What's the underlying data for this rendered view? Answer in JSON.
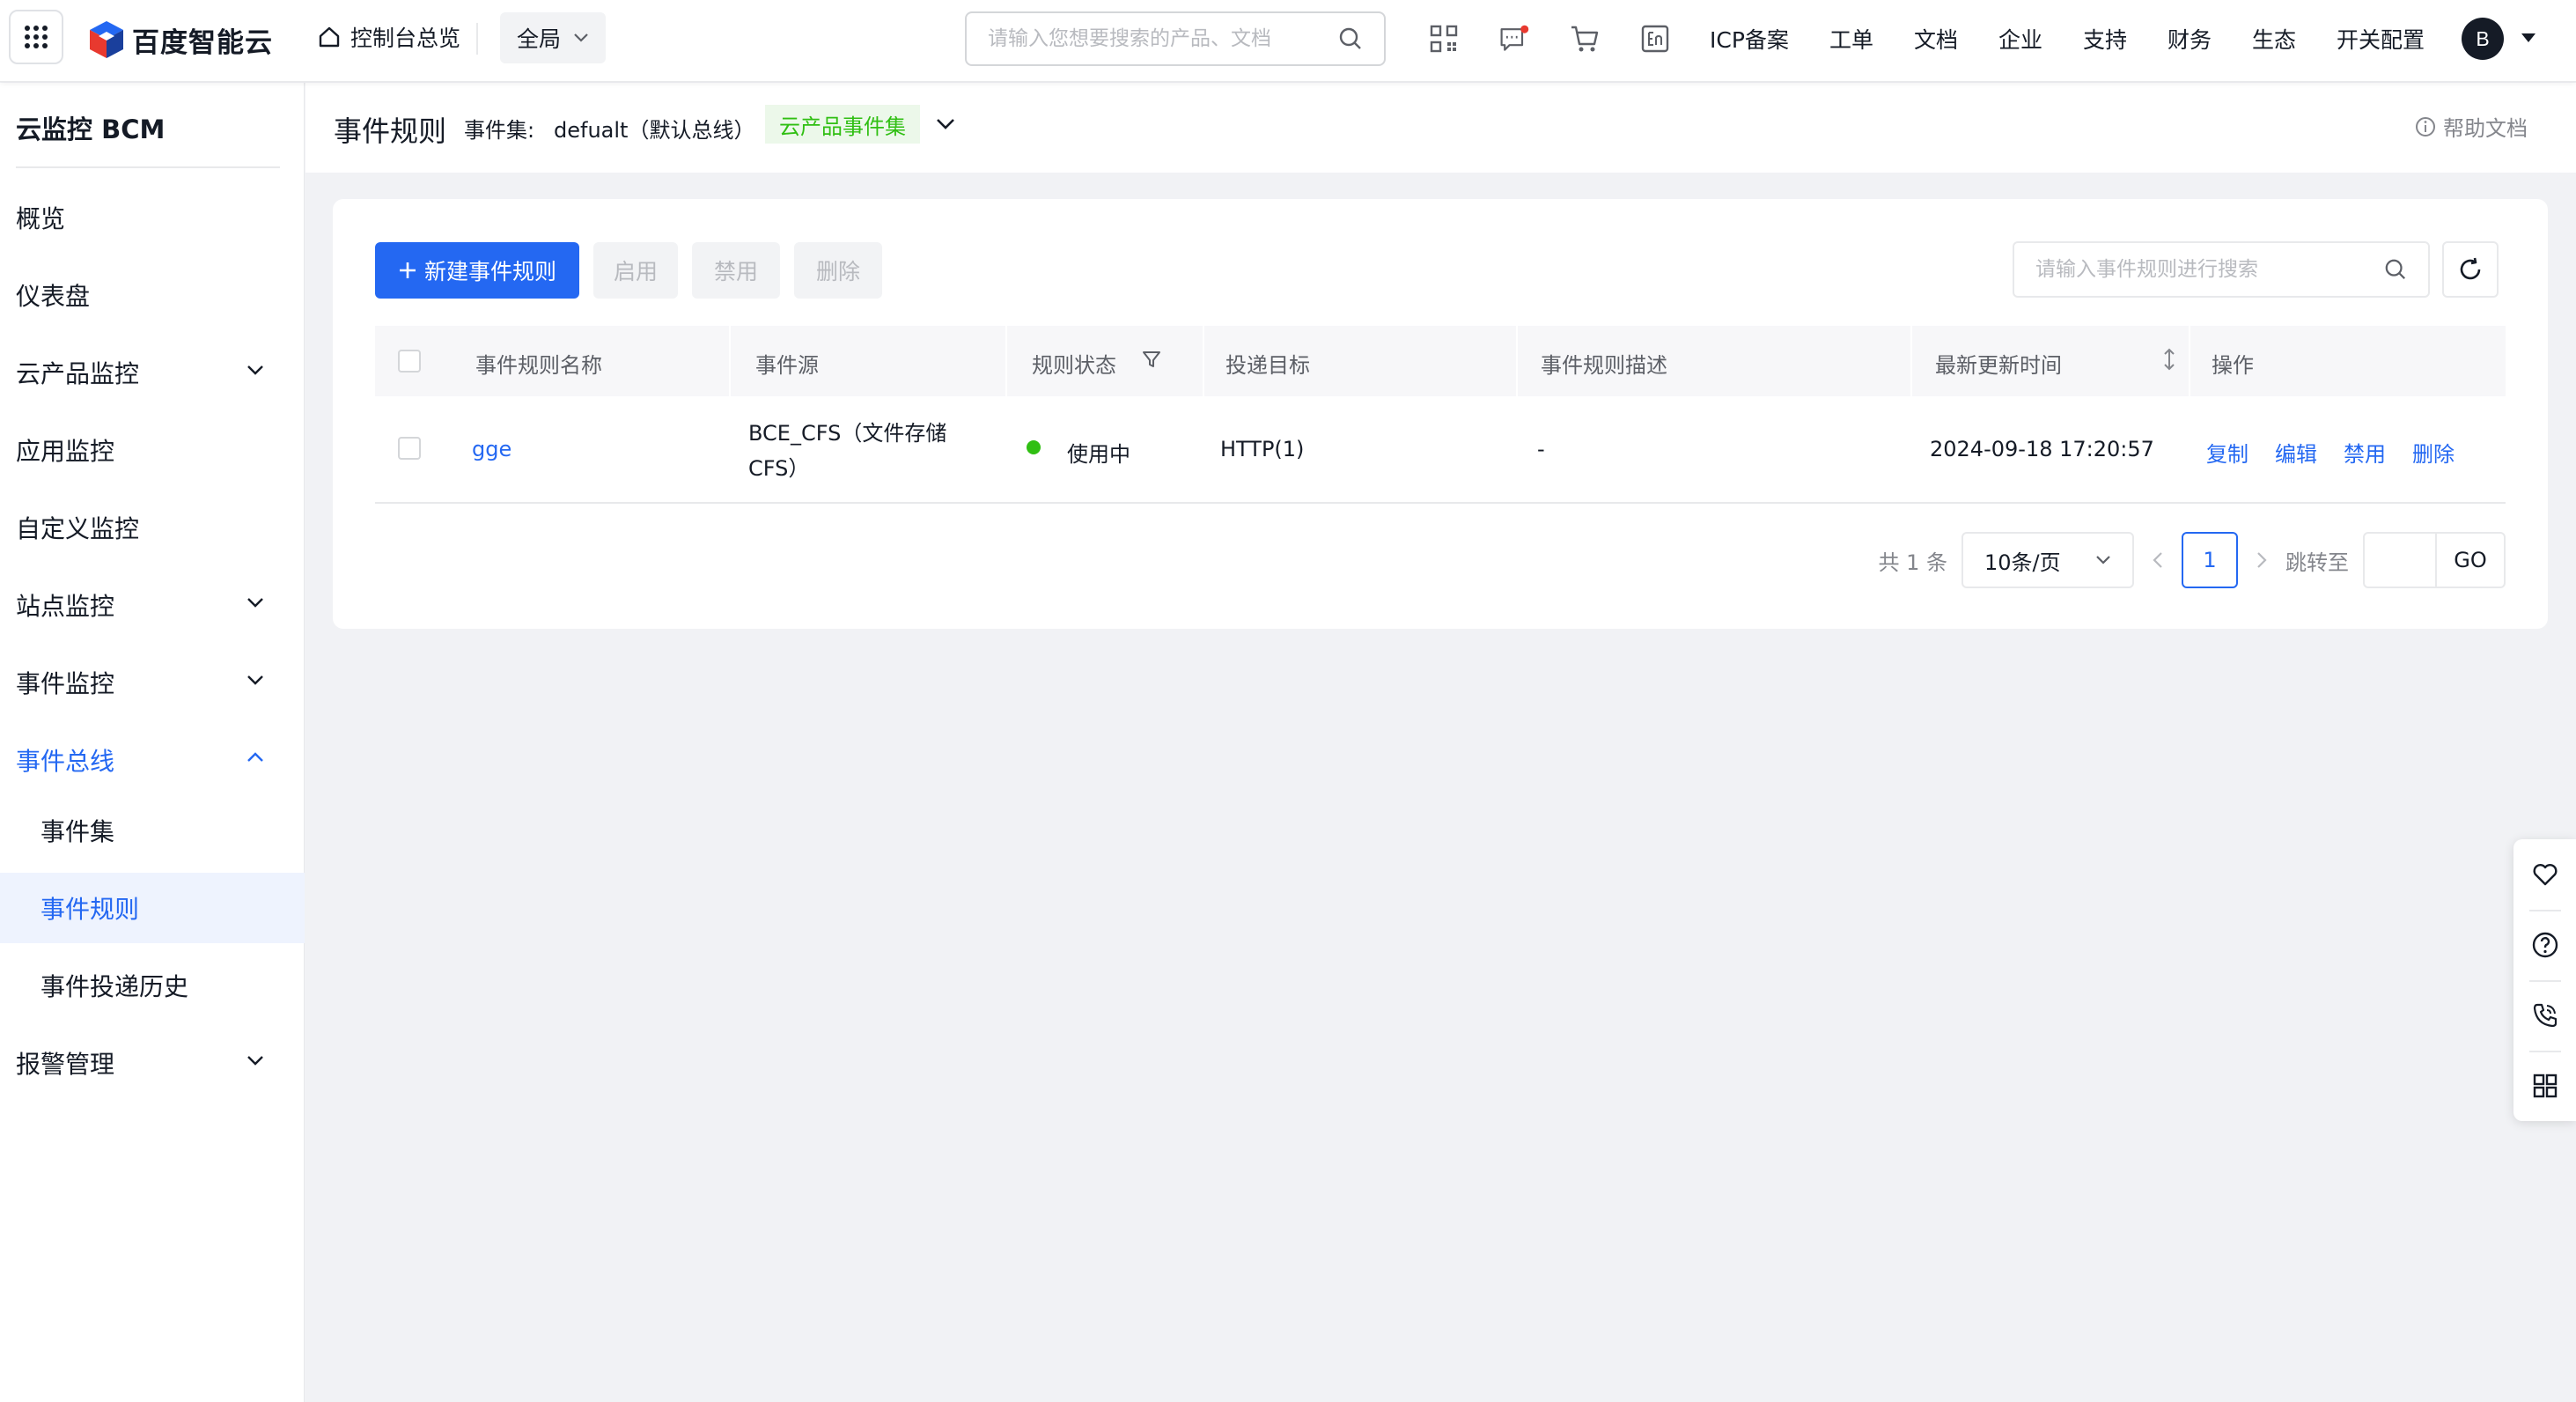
{
  "topbar": {
    "logo_text": "百度智能云",
    "console_label": "控制台总览",
    "region_label": "全局",
    "search_placeholder": "请输入您想要搜索的产品、文档",
    "nav": [
      "ICP备案",
      "工单",
      "文档",
      "企业",
      "支持",
      "财务",
      "生态",
      "开关配置"
    ],
    "avatar_letter": "B"
  },
  "sidebar": {
    "title": "云监控 BCM",
    "items": [
      {
        "label": "概览"
      },
      {
        "label": "仪表盘"
      },
      {
        "label": "云产品监控"
      },
      {
        "label": "应用监控"
      },
      {
        "label": "自定义监控"
      },
      {
        "label": "站点监控"
      },
      {
        "label": "事件监控"
      },
      {
        "label": "事件总线"
      },
      {
        "label": "事件集"
      },
      {
        "label": "事件规则"
      },
      {
        "label": "事件投递历史"
      },
      {
        "label": "报警管理"
      }
    ]
  },
  "header": {
    "title": "事件规则",
    "eventset_label": "事件集:",
    "eventset_value": "defualt（默认总线）",
    "tag": "云产品事件集",
    "help": "帮助文档"
  },
  "toolbar": {
    "create": "新建事件规则",
    "enable": "启用",
    "disable": "禁用",
    "delete": "删除",
    "search_placeholder": "请输入事件规则进行搜索"
  },
  "table": {
    "columns": [
      "事件规则名称",
      "事件源",
      "规则状态",
      "投递目标",
      "事件规则描述",
      "最新更新时间",
      "操作"
    ],
    "rows": [
      {
        "name": "gge",
        "source_line1": "BCE_CFS（文件存储",
        "source_line2": "CFS）",
        "status": "使用中",
        "target": "HTTP(1)",
        "description": "-",
        "updated": "2024-09-18 17:20:57",
        "actions": [
          "复制",
          "编辑",
          "禁用",
          "删除"
        ]
      }
    ]
  },
  "pager": {
    "total": "共 1 条",
    "page_size": "10条/页",
    "current": "1",
    "jump_label": "跳转至",
    "go": "GO"
  },
  "colors": {
    "primary": "#2468f2",
    "success": "#30bf13",
    "tag_bg": "#ecf8ea"
  },
  "floatbar_icons": [
    "heart-icon",
    "question-icon",
    "phone-icon",
    "apps-icon"
  ]
}
